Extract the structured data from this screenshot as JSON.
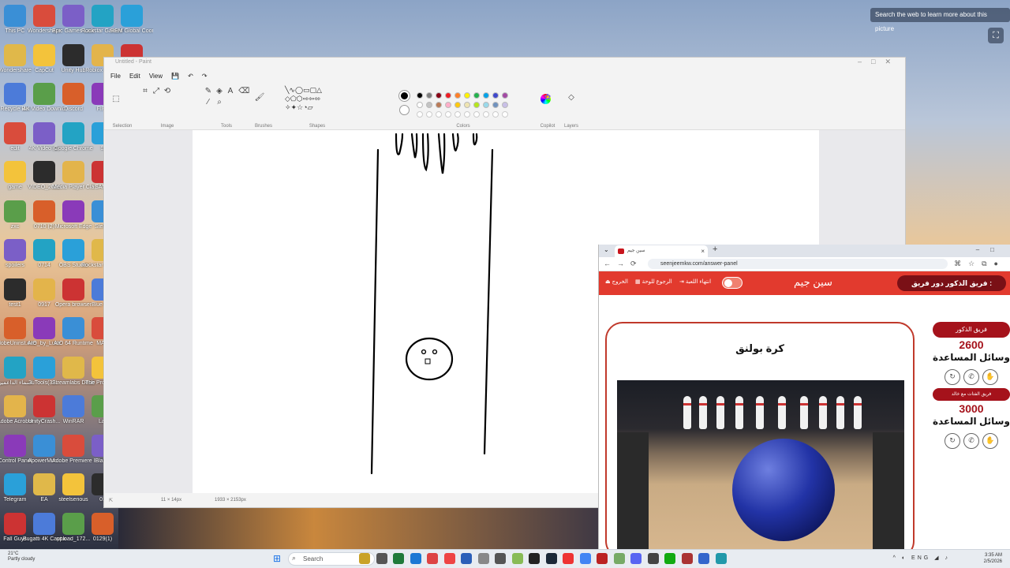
{
  "desktop": {
    "search_pic": "Search the web to learn more about this picture",
    "icons_col1": [
      "This PC",
      "Wondershare",
      "Recycle Bin",
      "edit",
      "game",
      "zxc",
      "spoilers",
      "test1",
      "AdobeUninst.exe",
      "اسماء الداعمين",
      "Adobe Acrobat",
      "Control Panel",
      "Telegram",
      "Fall Guys"
    ],
    "icons_col2": [
      "Wondershare",
      "CapCut",
      "4K Video Downloader",
      "4K Video (2)",
      "VIDEO_2022",
      "0710 (2)",
      "0714",
      "0917",
      "AIO_by_Luce",
      "3uTools(32...",
      "UnityCrash...",
      "ApowerMirr...",
      "EA",
      "Bugatti 4K Capture"
    ],
    "icons_col3": [
      "Epic Games Launcher",
      "Unity Hub",
      "Discord",
      "Google Chrome",
      "Media Player Classic",
      "Microsoft Edge",
      "OBS Studio",
      "Opera browser",
      "AIO 64 Runtime",
      "Streamlabs Desktop",
      "WinRAR",
      "Adobe Premiere P...",
      "steelserious",
      "upload_172..."
    ],
    "icons_col4": [
      "Rockstar Games Launcher",
      "Roblox Studio",
      "FIFA",
      "S",
      "SAMP",
      "Steam",
      "Rockstar Legends",
      "Blue Fire",
      "MAD",
      "The Professor",
      "Lar",
      "Blazin",
      "01",
      "0129(1)"
    ],
    "icons_col5": [
      "REM Global Coordinator",
      "Roblox"
    ]
  },
  "paint": {
    "title": "Untitled - Paint",
    "menu": [
      "File",
      "Edit",
      "View"
    ],
    "groups": [
      "Selection",
      "Image",
      "Tools",
      "Brushes",
      "Shapes",
      "Colors",
      "Copilot",
      "Layers"
    ],
    "colors_row1": [
      "#000000",
      "#7f7f7f",
      "#880015",
      "#ed1c24",
      "#ff7f27",
      "#fff200",
      "#22b14c",
      "#00a2e8",
      "#3f48cc",
      "#a349a4"
    ],
    "colors_row2": [
      "#ffffff",
      "#c3c3c3",
      "#b97a57",
      "#ffaec9",
      "#ffc90e",
      "#efe4b0",
      "#b5e61d",
      "#99d9ea",
      "#7092be",
      "#c8bfe7"
    ],
    "status_pos": "11 × 14px",
    "status_size": "1933 × 2153px"
  },
  "browser": {
    "tab_title": "سين جيم",
    "url": "seenjeemkw.com/answer-panel",
    "header": {
      "exit": "الخروج",
      "back_board": "الرجوع للوحة",
      "end_game": "انتهاء اللعبة",
      "brand": "سين جيم",
      "turn_label": "دور فريق :",
      "turn_team": "فريق الذكور"
    },
    "question": "كرة بولنق",
    "teams": [
      {
        "name": "فريق الذكور",
        "score": "2600",
        "aids_label": "وسائل المساعدة"
      },
      {
        "name": "فريق الفتات مع خالد",
        "score": "3000",
        "aids_label": "وسائل المساعدة"
      }
    ]
  },
  "taskbar": {
    "weather_temp": "21°C",
    "weather_desc": "Partly cloudy",
    "search": "Search",
    "lang": "ENG",
    "time": "3:35 AM",
    "date": "2/5/2026"
  }
}
